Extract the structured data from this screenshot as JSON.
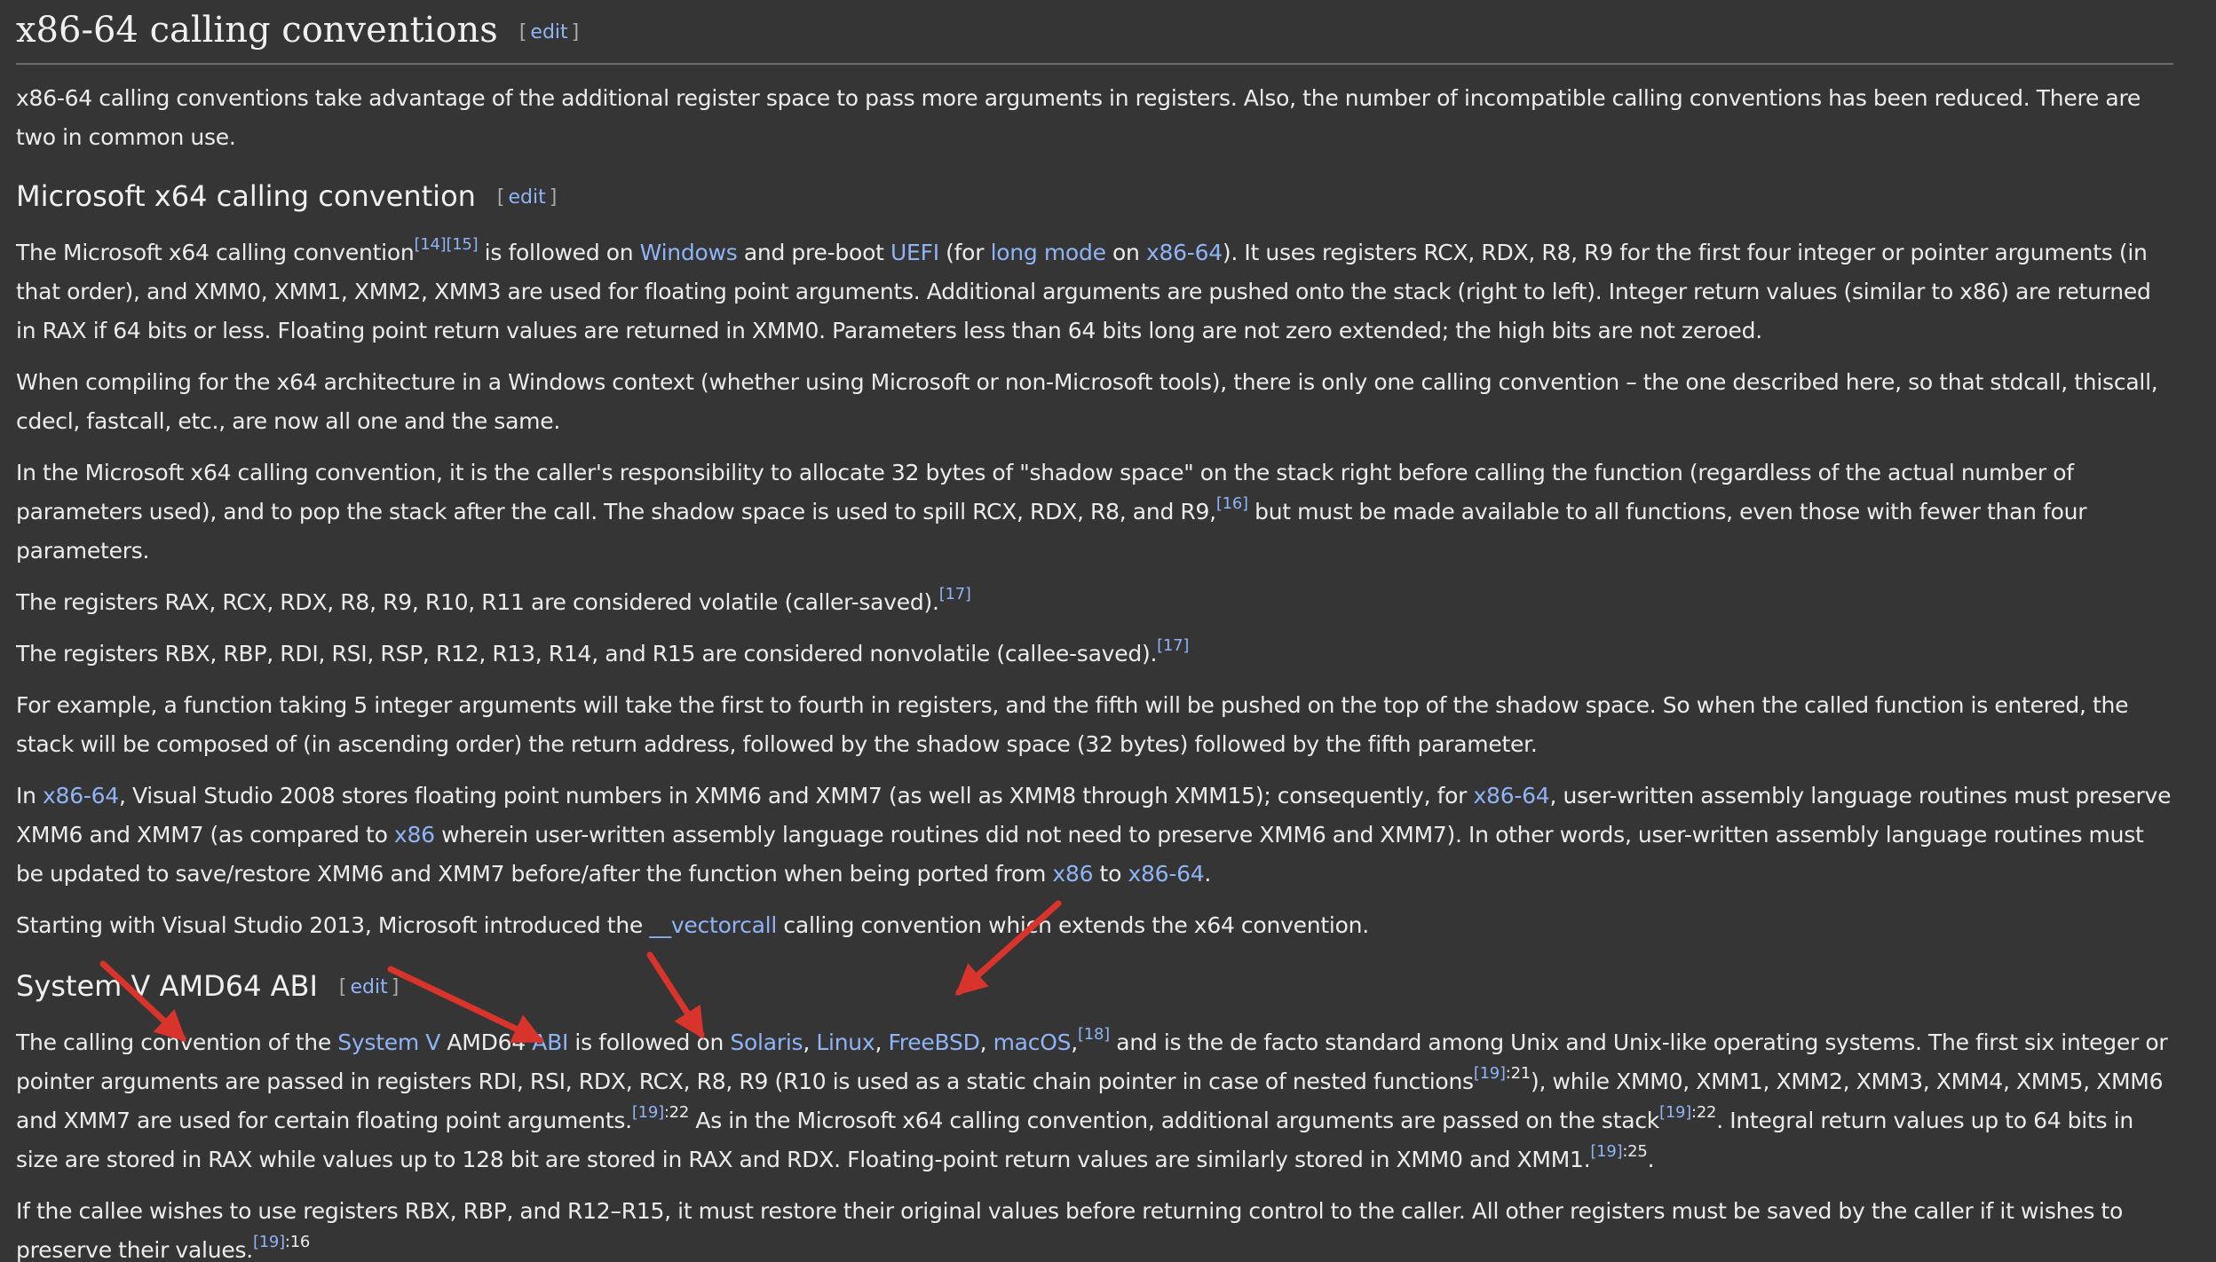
{
  "title": "x86-64 calling conventions",
  "edit": {
    "open": "[",
    "label": "edit",
    "close": "]"
  },
  "intro": "x86-64 calling conventions take advantage of the additional register space to pass more arguments in registers. Also, the number of incompatible calling conventions has been reduced. There are two in common use.",
  "ms": {
    "heading": "Microsoft x64 calling convention",
    "p1": {
      "t1": "The Microsoft x64 calling convention",
      "ref14": "[14]",
      "ref15": "[15]",
      "t2": " is followed on ",
      "windows": "Windows",
      "t3": " and pre-boot ",
      "uefi": "UEFI",
      "t4": " (for ",
      "longmode": "long mode",
      "t5": " on ",
      "x8664": "x86-64",
      "t6": "). It uses registers RCX, RDX, R8, R9 for the first four integer or pointer arguments (in that order), and XMM0, XMM1, XMM2, XMM3 are used for floating point arguments. Additional arguments are pushed onto the stack (right to left). Integer return values (similar to x86) are returned in RAX if 64 bits or less. Floating point return values are returned in XMM0. Parameters less than 64 bits long are not zero extended; the high bits are not zeroed."
    },
    "p2": "When compiling for the x64 architecture in a Windows context (whether using Microsoft or non-Microsoft tools), there is only one calling convention – the one described here, so that stdcall, thiscall, cdecl, fastcall, etc., are now all one and the same.",
    "p3": {
      "t1": "In the Microsoft x64 calling convention, it is the caller's responsibility to allocate 32 bytes of \"shadow space\" on the stack right before calling the function (regardless of the actual number of parameters used), and to pop the stack after the call. The shadow space is used to spill RCX, RDX, R8, and R9,",
      "ref16": "[16]",
      "t2": " but must be made available to all functions, even those with fewer than four parameters."
    },
    "p4": {
      "t1": "The registers RAX, RCX, RDX, R8, R9, R10, R11 are considered volatile (caller-saved).",
      "ref17": "[17]"
    },
    "p5": {
      "t1": "The registers RBX, RBP, RDI, RSI, RSP, R12, R13, R14, and R15 are considered nonvolatile (callee-saved).",
      "ref17": "[17]"
    },
    "p6": "For example, a function taking 5 integer arguments will take the first to fourth in registers, and the fifth will be pushed on the top of the shadow space. So when the called function is entered, the stack will be composed of (in ascending order) the return address, followed by the shadow space (32 bytes) followed by the fifth parameter.",
    "p7": {
      "t1": "In ",
      "l1": "x86-64",
      "t2": ", Visual Studio 2008 stores floating point numbers in XMM6 and XMM7 (as well as XMM8 through XMM15); consequently, for ",
      "l2": "x86-64",
      "t3": ", user-written assembly language routines must preserve XMM6 and XMM7 (as compared to ",
      "l3": "x86",
      "t4": " wherein user-written assembly language routines did not need to preserve XMM6 and XMM7). In other words, user-written assembly language routines must be updated to save/restore XMM6 and XMM7 before/after the function when being ported from ",
      "l4": "x86",
      "t5": " to ",
      "l5": "x86-64",
      "t6": "."
    },
    "p8": {
      "t1": "Starting with Visual Studio 2013, Microsoft introduced the ",
      "link": "__vectorcall",
      "t2": " calling convention which extends the x64 convention."
    }
  },
  "sysv": {
    "heading": "System V AMD64 ABI",
    "p1": {
      "t1": "The calling convention of the ",
      "systemv": "System V",
      "t2": " AMD64 ",
      "abi": "ABI",
      "t3": " is followed on ",
      "solaris": "Solaris",
      "c1": ", ",
      "linux": "Linux",
      "c2": ", ",
      "freebsd": "FreeBSD",
      "c3": ", ",
      "macos": "macOS",
      "c4": ",",
      "ref18": "[18]",
      "t4": " and is the de facto standard among Unix and Unix-like operating systems. The first six integer or pointer arguments are passed in registers RDI, RSI, RDX, RCX, R8, R9 (R10 is used as a static chain pointer in case of nested functions",
      "ref19a": "[19]",
      "pg21": ":21",
      "t5": "), while XMM0, XMM1, XMM2, XMM3, XMM4, XMM5, XMM6 and XMM7 are used for certain floating point arguments.",
      "ref19b": "[19]",
      "pg22a": ":22",
      "t6": " As in the Microsoft x64 calling convention, additional arguments are passed on the stack",
      "ref19c": "[19]",
      "pg22b": ":22",
      "t7": ". Integral return values up to 64 bits in size are stored in RAX while values up to 128 bit are stored in RAX and RDX. Floating-point return values are similarly stored in XMM0 and XMM1.",
      "ref19d": "[19]",
      "pg25": ":25",
      "t8": "."
    },
    "p2": {
      "t1": "If the callee wishes to use registers RBX, RBP, and R12–R15, it must restore their original values before returning control to the caller. All other registers must be saved by the caller if it wishes to preserve their values.",
      "ref19": "[19]",
      "pg16": ":16"
    }
  },
  "colors": {
    "background": "#353535",
    "text": "#ececec",
    "link": "#8fb4f6",
    "annotation_arrow": "#d9342b"
  }
}
